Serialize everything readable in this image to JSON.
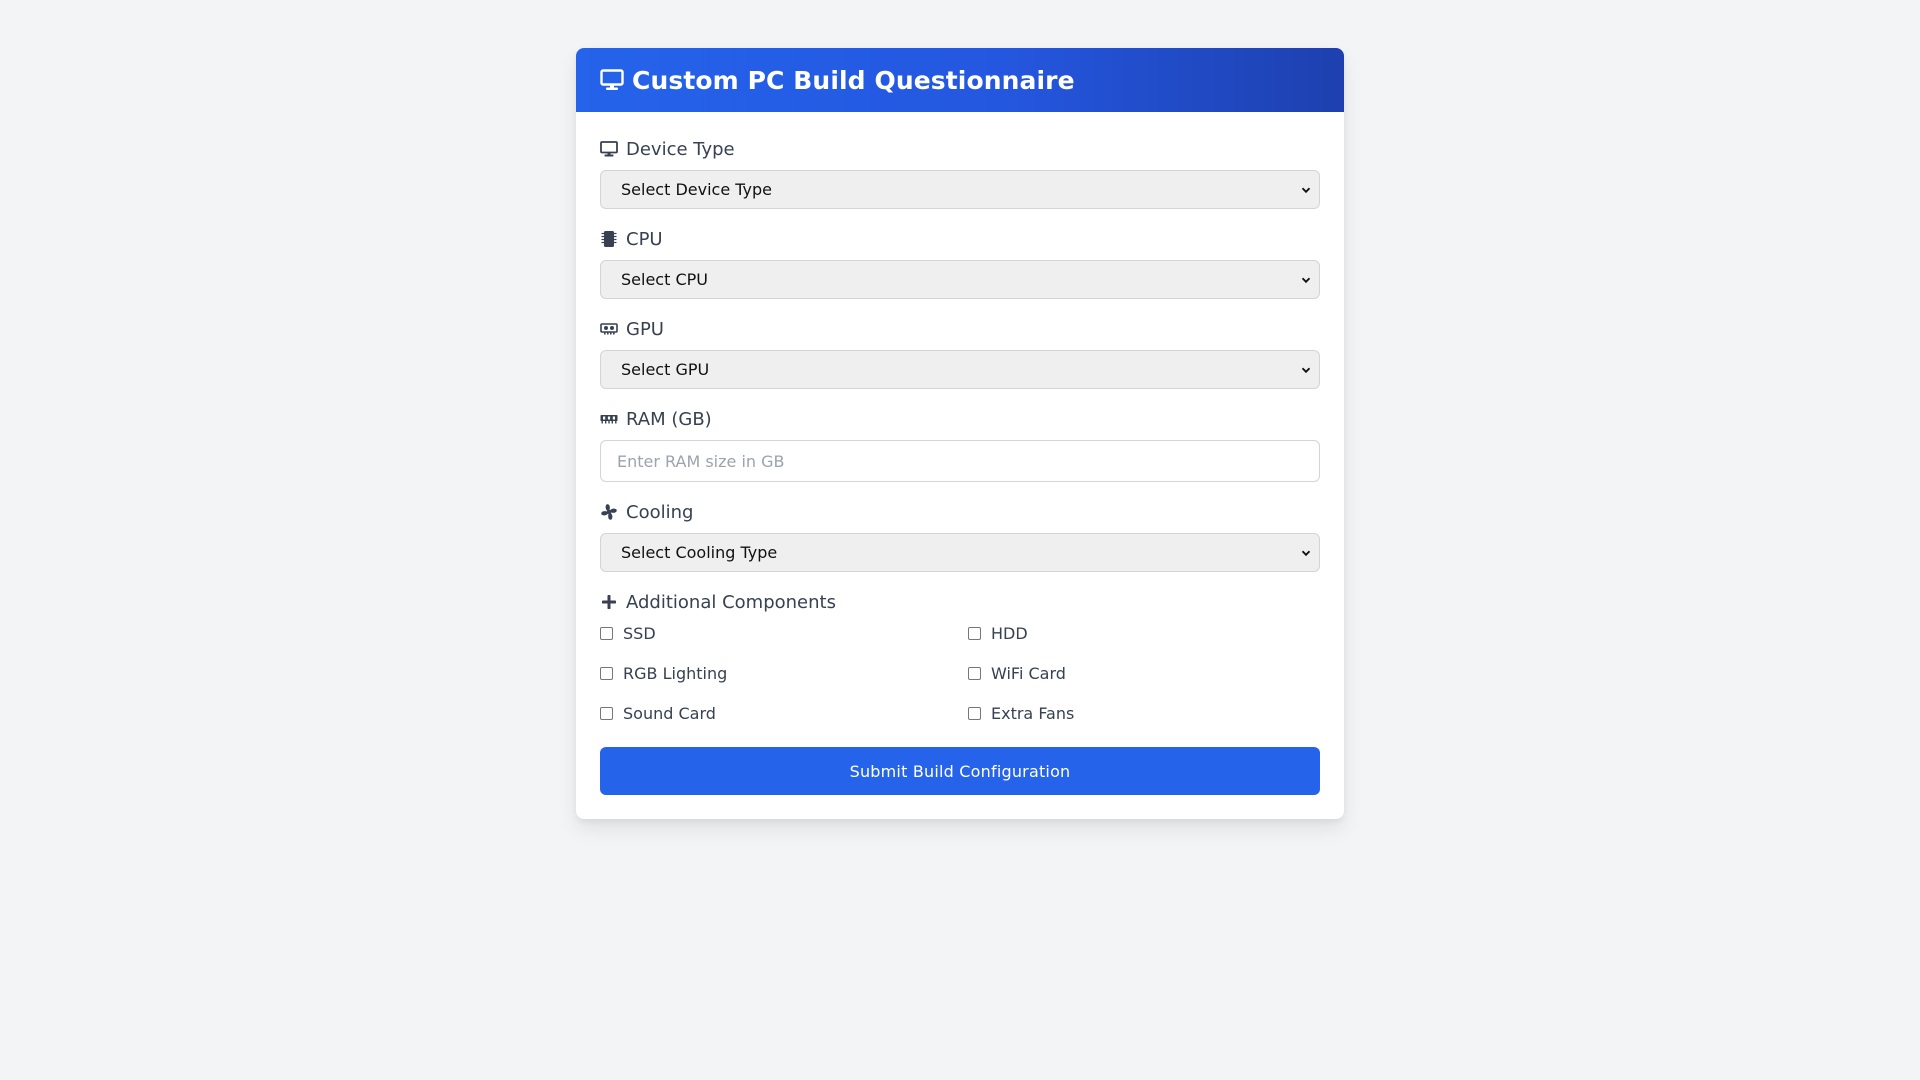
{
  "header": {
    "title": "Custom PC Build Questionnaire",
    "icon": "monitor-icon"
  },
  "fields": {
    "device_type": {
      "label": "Device Type",
      "icon": "monitor-icon",
      "selected": "Select Device Type"
    },
    "cpu": {
      "label": "CPU",
      "icon": "microchip-icon",
      "selected": "Select CPU"
    },
    "gpu": {
      "label": "GPU",
      "icon": "graphics-card-icon",
      "selected": "Select GPU"
    },
    "ram": {
      "label": "RAM (GB)",
      "icon": "memory-icon",
      "placeholder": "Enter RAM size in GB",
      "value": ""
    },
    "cooling": {
      "label": "Cooling",
      "icon": "fan-icon",
      "selected": "Select Cooling Type"
    }
  },
  "additional": {
    "label": "Additional Components",
    "icon": "plus-icon",
    "options": [
      {
        "label": "SSD",
        "checked": false
      },
      {
        "label": "HDD",
        "checked": false
      },
      {
        "label": "RGB Lighting",
        "checked": false
      },
      {
        "label": "WiFi Card",
        "checked": false
      },
      {
        "label": "Sound Card",
        "checked": false
      },
      {
        "label": "Extra Fans",
        "checked": false
      }
    ]
  },
  "submit": {
    "label": "Submit Build Configuration"
  },
  "colors": {
    "accent": "#2563eb",
    "header_end": "#1e40af",
    "background": "#f3f4f6"
  }
}
